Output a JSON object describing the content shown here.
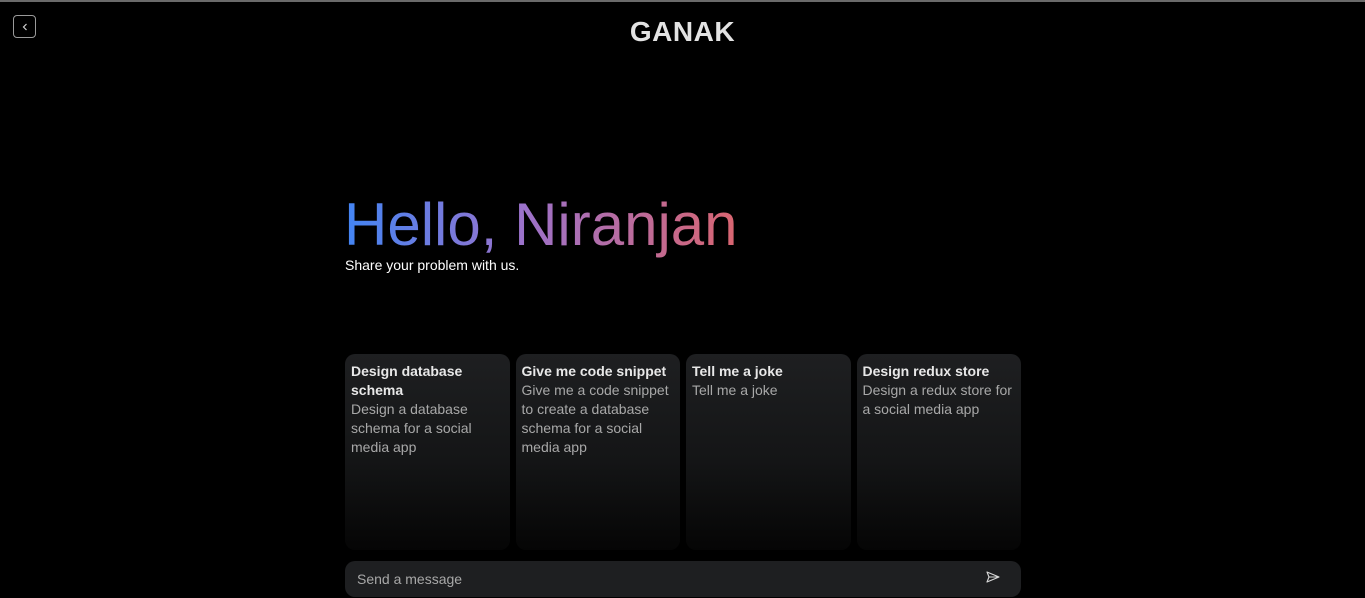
{
  "header": {
    "brand": "GANAK",
    "back_icon": "chevron-left-icon"
  },
  "hero": {
    "greeting": "Hello, Niranjan",
    "subtitle": "Share your problem with us.",
    "gradient_colors": [
      "#4285f4",
      "#9b72cb",
      "#d96570"
    ]
  },
  "suggestions": [
    {
      "title": "Design database schema",
      "description": "Design a database schema for a social media app"
    },
    {
      "title": "Give me code snippet",
      "description": "Give me a code snippet to create a database schema for a social media app"
    },
    {
      "title": "Tell me a joke",
      "description": "Tell me a joke"
    },
    {
      "title": "Design redux store",
      "description": "Design a redux store for a social media app"
    }
  ],
  "composer": {
    "placeholder": "Send a message",
    "value": "",
    "send_icon": "send-icon"
  }
}
